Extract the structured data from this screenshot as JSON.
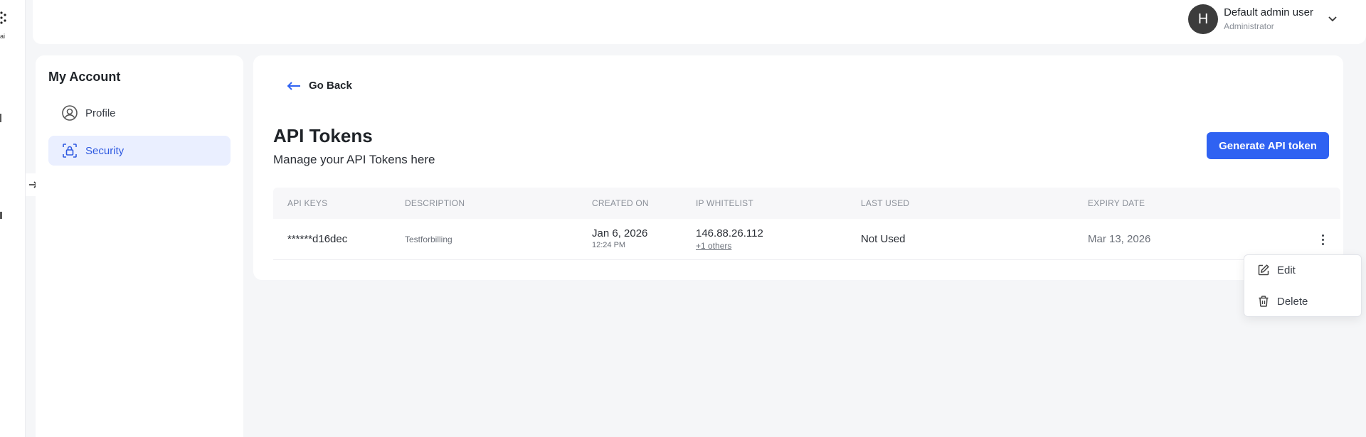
{
  "rail": {
    "logo_text": "ai"
  },
  "header": {
    "avatar_initial": "H",
    "user_name": "Default admin user",
    "user_role": "Administrator"
  },
  "sidebar": {
    "title": "My Account",
    "items": [
      {
        "label": "Profile",
        "icon": "user-circle-icon",
        "active": false
      },
      {
        "label": "Security",
        "icon": "lock-icon",
        "active": true
      }
    ]
  },
  "main": {
    "go_back_label": "Go Back",
    "title": "API Tokens",
    "subtitle": "Manage your API Tokens here",
    "generate_label": "Generate API token",
    "table": {
      "columns": [
        "API KEYS",
        "DESCRIPTION",
        "CREATED ON",
        "IP WHITELIST",
        "LAST USED",
        "EXPIRY DATE"
      ],
      "rows": [
        {
          "api_key": "******d16dec",
          "description": "Testforbilling",
          "created_date": "Jan 6, 2026",
          "created_time": "12:24 PM",
          "ip": "146.88.26.112",
          "ip_more": "+1 others",
          "last_used": "Not Used",
          "expiry": "Mar 13, 2026"
        }
      ]
    }
  },
  "row_menu": {
    "items": [
      {
        "label": "Edit",
        "icon": "edit-icon"
      },
      {
        "label": "Delete",
        "icon": "trash-icon"
      }
    ]
  },
  "colors": {
    "accent": "#2f62f2",
    "active_bg": "#eaefff",
    "active_text": "#2f5ae0"
  }
}
